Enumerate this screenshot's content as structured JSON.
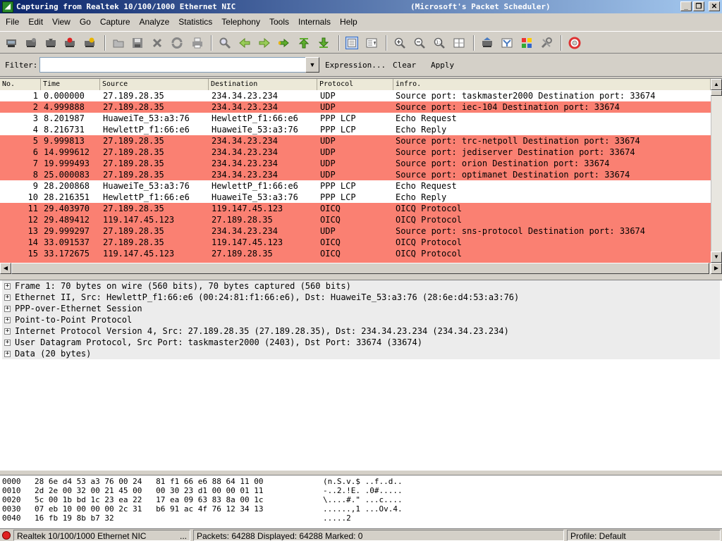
{
  "window": {
    "title": "Capturing from Realtek 10/100/1000 Ethernet NIC",
    "title_suffix": "(Microsoft's Packet Scheduler)",
    "min_glyph": "_",
    "max_glyph": "❐",
    "close_glyph": "✕"
  },
  "menu": [
    "File",
    "Edit",
    "View",
    "Go",
    "Capture",
    "Analyze",
    "Statistics",
    "Telephony",
    "Tools",
    "Internals",
    "Help"
  ],
  "filter": {
    "label": "Filter:",
    "value": "",
    "expression": "Expression...",
    "clear": "Clear",
    "apply": "Apply"
  },
  "packet_list": {
    "columns": [
      "No.",
      "Time",
      "Source",
      "Destination",
      "Protocol",
      "infro."
    ],
    "rows": [
      {
        "no": "1",
        "time": "0.000000",
        "src": "27.189.28.35",
        "dst": "234.34.23.234",
        "proto": "UDP",
        "info": "Source port: taskmaster2000  Destination port: 33674",
        "color": "white"
      },
      {
        "no": "2",
        "time": "4.999888",
        "src": "27.189.28.35",
        "dst": "234.34.23.234",
        "proto": "UDP",
        "info": "Source port: iec-104  Destination port: 33674",
        "color": "salmon"
      },
      {
        "no": "3",
        "time": "8.201987",
        "src": "HuaweiTe_53:a3:76",
        "dst": "HewlettP_f1:66:e6",
        "proto": "PPP LCP",
        "info": "Echo Request",
        "color": "white"
      },
      {
        "no": "4",
        "time": "8.216731",
        "src": "HewlettP_f1:66:e6",
        "dst": "HuaweiTe_53:a3:76",
        "proto": "PPP LCP",
        "info": "Echo Reply",
        "color": "white"
      },
      {
        "no": "5",
        "time": "9.999813",
        "src": "27.189.28.35",
        "dst": "234.34.23.234",
        "proto": "UDP",
        "info": "Source port: trc-netpoll  Destination port: 33674",
        "color": "salmon"
      },
      {
        "no": "6",
        "time": "14.999612",
        "src": "27.189.28.35",
        "dst": "234.34.23.234",
        "proto": "UDP",
        "info": "Source port: jediserver  Destination port: 33674",
        "color": "salmon"
      },
      {
        "no": "7",
        "time": "19.999493",
        "src": "27.189.28.35",
        "dst": "234.34.23.234",
        "proto": "UDP",
        "info": "Source port: orion  Destination port: 33674",
        "color": "salmon"
      },
      {
        "no": "8",
        "time": "25.000083",
        "src": "27.189.28.35",
        "dst": "234.34.23.234",
        "proto": "UDP",
        "info": "Source port: optimanet  Destination port: 33674",
        "color": "salmon"
      },
      {
        "no": "9",
        "time": "28.200868",
        "src": "HuaweiTe_53:a3:76",
        "dst": "HewlettP_f1:66:e6",
        "proto": "PPP LCP",
        "info": "Echo Request",
        "color": "white"
      },
      {
        "no": "10",
        "time": "28.216351",
        "src": "HewlettP_f1:66:e6",
        "dst": "HuaweiTe_53:a3:76",
        "proto": "PPP LCP",
        "info": "Echo Reply",
        "color": "white"
      },
      {
        "no": "11",
        "time": "29.403970",
        "src": "27.189.28.35",
        "dst": "119.147.45.123",
        "proto": "OICQ",
        "info": "OICQ Protocol",
        "color": "salmon"
      },
      {
        "no": "12",
        "time": "29.489412",
        "src": "119.147.45.123",
        "dst": "27.189.28.35",
        "proto": "OICQ",
        "info": "OICQ Protocol",
        "color": "salmon"
      },
      {
        "no": "13",
        "time": "29.999297",
        "src": "27.189.28.35",
        "dst": "234.34.23.234",
        "proto": "UDP",
        "info": "Source port: sns-protocol  Destination port: 33674",
        "color": "salmon"
      },
      {
        "no": "14",
        "time": "33.091537",
        "src": "27.189.28.35",
        "dst": "119.147.45.123",
        "proto": "OICQ",
        "info": "OICQ Protocol",
        "color": "salmon"
      },
      {
        "no": "15",
        "time": "33.172675",
        "src": "119.147.45.123",
        "dst": "27.189.28.35",
        "proto": "OICQ",
        "info": "OICQ Protocol",
        "color": "salmon"
      }
    ]
  },
  "details": [
    "Frame 1: 70 bytes on wire (560 bits), 70 bytes captured (560 bits)",
    "Ethernet II, Src: HewlettP_f1:66:e6 (00:24:81:f1:66:e6), Dst: HuaweiTe_53:a3:76 (28:6e:d4:53:a3:76)",
    "PPP-over-Ethernet Session",
    "Point-to-Point Protocol",
    "Internet Protocol Version 4, Src: 27.189.28.35 (27.189.28.35), Dst: 234.34.23.234 (234.34.23.234)",
    "User Datagram Protocol, Src Port: taskmaster2000 (2403), Dst Port: 33674 (33674)",
    "Data (20 bytes)"
  ],
  "hex": [
    {
      "offset": "0000",
      "bytes": "28 6e d4 53 a3 76 00 24   81 f1 66 e6 88 64 11 00",
      "ascii": "(n.S.v.$ ..f..d.."
    },
    {
      "offset": "0010",
      "bytes": "2d 2e 00 32 00 21 45 00   00 30 23 d1 00 00 01 11",
      "ascii": "-..2.!E. .0#....."
    },
    {
      "offset": "0020",
      "bytes": "5c 00 1b bd 1c 23 ea 22   17 ea 09 63 83 8a 00 1c",
      "ascii": "\\....#.\" ...c...."
    },
    {
      "offset": "0030",
      "bytes": "07 eb 10 00 00 00 2c 31   b6 91 ac 4f 76 12 34 13",
      "ascii": "......,1 ...Ov.4."
    },
    {
      "offset": "0040",
      "bytes": "16 fb 19 8b b7 32",
      "ascii": ".....2"
    }
  ],
  "status": {
    "interface": "Realtek 10/100/1000 Ethernet NIC",
    "ellipsis": "...",
    "packets": "Packets: 64288 Displayed: 64288 Marked: 0",
    "profile": "Profile: Default"
  },
  "colors": {
    "salmon": "#fa8072",
    "white": "#ffffff"
  }
}
